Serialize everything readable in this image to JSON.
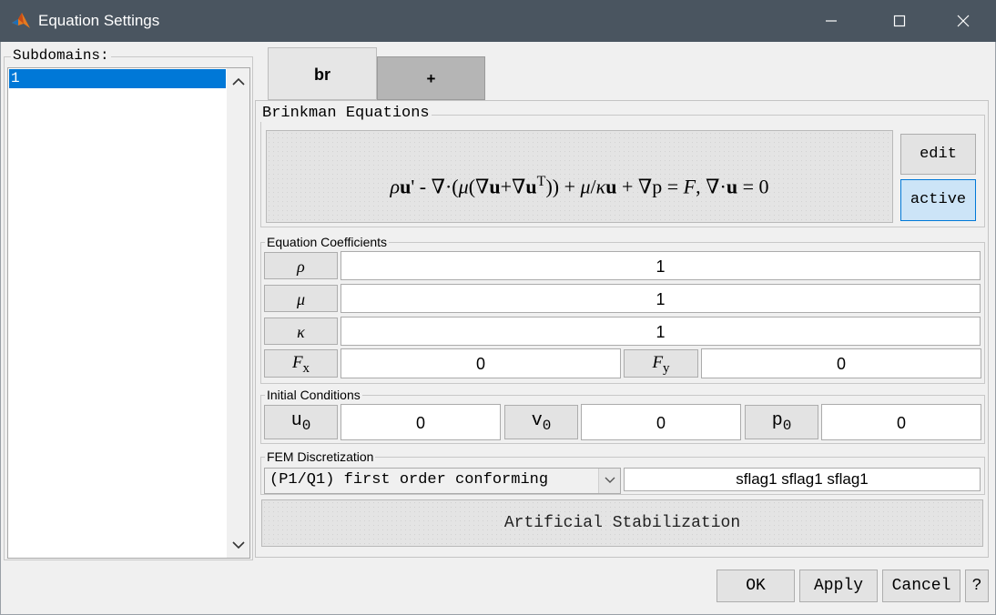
{
  "window": {
    "title": "Equation Settings",
    "icon": "matlab-icon",
    "controls": [
      "minimize-icon",
      "maximize-icon",
      "close-icon"
    ]
  },
  "subdomains": {
    "label": "Subdomains:",
    "items": [
      "1"
    ],
    "selected": "1"
  },
  "tabs": [
    {
      "label": "br",
      "active": true
    },
    {
      "label": "+",
      "active": false
    }
  ],
  "equation": {
    "group_label": "Brinkman Equations",
    "edit_label": "edit",
    "active_label": "active"
  },
  "coefficients": {
    "group_label": "Equation Coefficients",
    "rho": {
      "symbol": "ρ",
      "value": "1"
    },
    "mu": {
      "symbol": "μ",
      "value": "1"
    },
    "kappa": {
      "symbol": "κ",
      "value": "1"
    },
    "fx": {
      "symbol": "F",
      "sub": "x",
      "value": "0"
    },
    "fy": {
      "symbol": "F",
      "sub": "y",
      "value": "0"
    }
  },
  "initial": {
    "group_label": "Initial Conditions",
    "u0": {
      "symbol": "u",
      "sub": "0",
      "value": "0"
    },
    "v0": {
      "symbol": "v",
      "sub": "0",
      "value": "0"
    },
    "p0": {
      "symbol": "p",
      "sub": "0",
      "value": "0"
    }
  },
  "fem": {
    "group_label": "FEM Discretization",
    "selected": "(P1/Q1) first order conforming",
    "sflags": "sflag1 sflag1 sflag1"
  },
  "stabilization_label": "Artificial Stabilization",
  "footer": {
    "ok": "OK",
    "apply": "Apply",
    "cancel": "Cancel",
    "help": "?"
  },
  "colors": {
    "titlebar": "#4a5560",
    "selection": "#0078d7",
    "active_button": "#cce4f7"
  }
}
